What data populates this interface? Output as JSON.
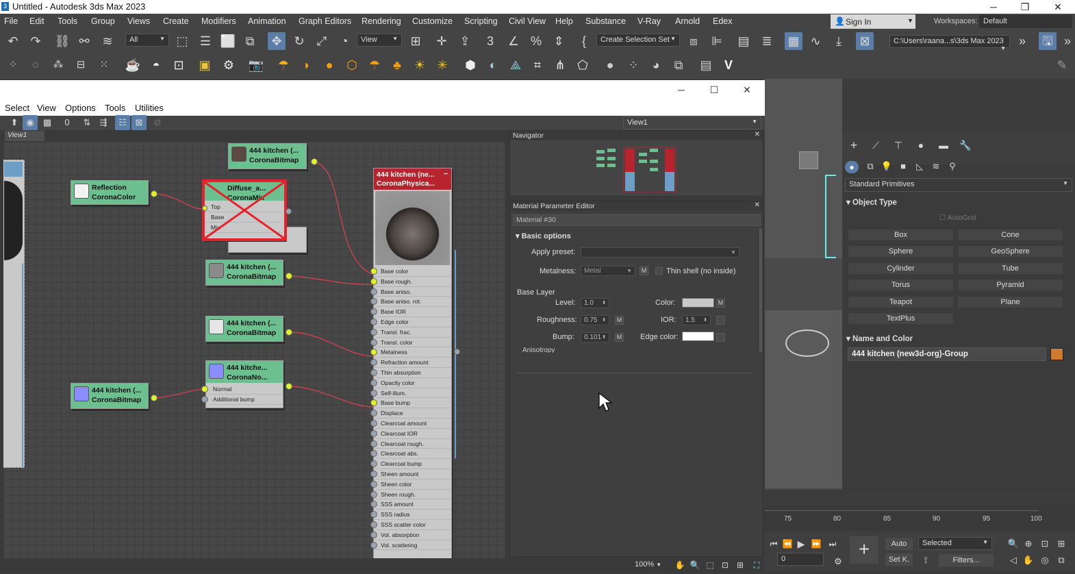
{
  "app": {
    "title": "Untitled - Autodesk 3ds Max 2023",
    "icon_label": "3"
  },
  "menu": [
    "File",
    "Edit",
    "Tools",
    "Group",
    "Views",
    "Create",
    "Modifiers",
    "Animation",
    "Graph Editors",
    "Rendering",
    "Customize",
    "Scripting",
    "Civil View",
    "Help",
    "Substance",
    "V-Ray",
    "Arnold",
    "Edex"
  ],
  "signin": "Sign In",
  "workspaces_label": "Workspaces:",
  "workspace_value": "Default",
  "toolbar": {
    "filter": "All",
    "ref_coord": "View",
    "selection_set": "Create Selection Set",
    "path": "C:\\Users\\raana...s\\3ds Max 2023"
  },
  "slate": {
    "menu": [
      "Select",
      "View",
      "Options",
      "Tools",
      "Utilities"
    ],
    "view_dropdown": "View1",
    "view_tab": "View1",
    "nodes": {
      "reflection": {
        "line1": "Reflection",
        "line2": "CoronaColor"
      },
      "top_bitmap": {
        "line1": "444 kitchen (...",
        "line2": "CoronaBitmap"
      },
      "mix": {
        "line1": "Diffuse_a...",
        "line2": "CoronaMix",
        "slots": [
          "Top",
          "Base",
          "Mix"
        ]
      },
      "bitmap2": {
        "line1": "444 kitchen (...",
        "line2": "CoronaBitmap"
      },
      "bitmap3": {
        "line1": "444 kitchen (...",
        "line2": "CoronaBitmap"
      },
      "normal": {
        "line1": "444 kitche...",
        "line2": "CoronaNo...",
        "slots": [
          "Normal",
          "Additional bump"
        ]
      },
      "bitmap4": {
        "line1": "444 kitchen (...",
        "line2": "CoronaBitmap"
      },
      "material": {
        "line1": "444 kitchen (ne...",
        "line2": "CoronaPhysica...",
        "slots": [
          "Base color",
          "Base rough.",
          "Base aniso.",
          "Base aniso. rot.",
          "Base IOR",
          "Edge color",
          "Transl. frac.",
          "Transl. color",
          "Metalness",
          "Refraction amount",
          "Thin absorption",
          "Opacity color",
          "Self-illum.",
          "Base bump",
          "Displace",
          "Clearcoat amount",
          "Clearcoat IOR",
          "Clearcoat rough.",
          "Clearcoat abs.",
          "Clearcoat bump",
          "Sheen amount",
          "Sheen color",
          "Sheen rough.",
          "SSS amount",
          "SSS radius",
          "SSS scatter color",
          "Vol. absorption",
          "Vol. scattering"
        ]
      }
    },
    "navigator": "Navigator",
    "mpe": {
      "title": "Material Parameter Editor",
      "material_name": "Material #30",
      "section": "Basic options",
      "apply_preset_label": "Apply preset:",
      "metalness_label": "Metalness:",
      "metalness_value": "Metal",
      "m": "M",
      "thin_shell": "Thin shell (no inside)",
      "base_layer": "Base Layer",
      "level_label": "Level:",
      "level_value": "1.0",
      "color_label": "Color:",
      "roughness_label": "Roughness:",
      "roughness_value": "0.75",
      "ior_label": "IOR:",
      "ior_value": "1.5",
      "bump_label": "Bump:",
      "bump_value": "0.101",
      "edge_color_label": "Edge color:",
      "anisotropy": "Anisotropy"
    },
    "zoom": "100%"
  },
  "cmd": {
    "category": "Standard Primitives",
    "object_type": "Object Type",
    "autogrid": "AutoGrid",
    "buttons": [
      "Box",
      "Cone",
      "Sphere",
      "GeoSphere",
      "Cylinder",
      "Tube",
      "Torus",
      "Pyramid",
      "Teapot",
      "Plane",
      "TextPlus"
    ],
    "name_and_color": "Name and Color",
    "object_name": "444 kitchen (new3d-org)-Group",
    "object_color": "#d07a30"
  },
  "timeline": {
    "ticks": [
      "75",
      "80",
      "85",
      "90",
      "95",
      "100"
    ]
  },
  "anim": {
    "auto": "Auto",
    "set_key": "Set K.",
    "selected": "Selected",
    "filters": "Filters...",
    "frame": "0"
  }
}
